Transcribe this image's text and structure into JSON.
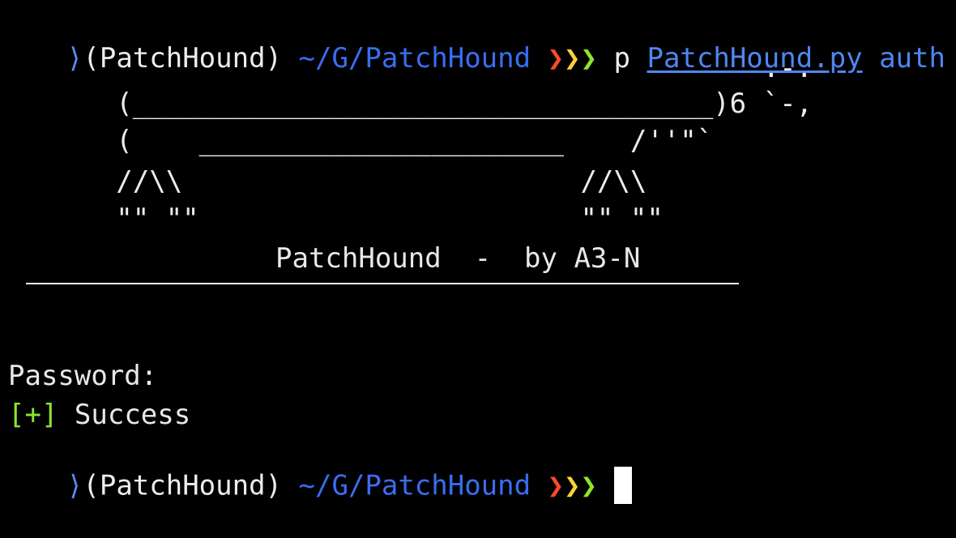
{
  "prompt_top": {
    "marker": "⟩",
    "env": "(PatchHound)",
    "path": "~/G/PatchHound",
    "chevrons": [
      "❯",
      "❯",
      "❯"
    ],
    "command": "p",
    "arg_file": "PatchHound.py",
    "arg_sub": "auth"
  },
  "banner": {
    "ascii_lines": [
      "                                              .-.",
      "       (___________________________________)6 `-,",
      "       (    ______________________    /''\"`",
      "       //\\\\                        //\\\\",
      "       \"\" \"\"                       \"\" \"\""
    ],
    "title": "PatchHound  -  by A3-N"
  },
  "output": {
    "password_label": "Password:",
    "success_tag": "[+]",
    "success_text": "Success"
  },
  "prompt_bottom": {
    "marker": "⟩",
    "env": "(PatchHound)",
    "path": "~/G/PatchHound",
    "chevrons": [
      "❯",
      "❯",
      "❯"
    ]
  },
  "colors": {
    "background": "#000000",
    "path": "#3a6df0",
    "chevron_red": "#ff4a2a",
    "chevron_yellow": "#ffd23a",
    "chevron_green": "#8ce62c",
    "success_tag": "#8ce62c"
  }
}
